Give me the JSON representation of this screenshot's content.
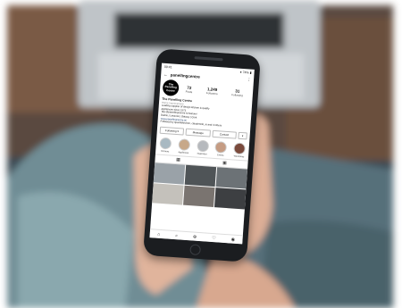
{
  "status": {
    "time": "09:41",
    "battery": "● 74% ▮"
  },
  "header": {
    "username": "panellingcentre",
    "back_icon": "back-arrow-icon",
    "menu_icon": "more-icon"
  },
  "profile": {
    "avatar_text": "The Panelling Centre",
    "stats": [
      {
        "value": "72",
        "label": "Posts"
      },
      {
        "value": "1,249",
        "label": "Followers"
      },
      {
        "value": "31",
        "label": "Following"
      }
    ]
  },
  "bio": {
    "name": "The Panelling Centre",
    "category": "Home Improvement",
    "line1": "Leading supplier of design kitchen & quality",
    "line2": "appliances since 1973.",
    "line3": "Tag @panellingcentre to feature!",
    "line4": "Dublin | Limerick | Galway | Cork",
    "link": "www.panellingcentre.ie/",
    "followed_by": "Followed by sparklekitchen, claudenolo_ie and 4 others"
  },
  "actions": {
    "following": "Following ▾",
    "message": "Message",
    "contact": "Contact",
    "more": "▾"
  },
  "highlights": [
    {
      "label": "Kitchens",
      "color": "#a9b9c2"
    },
    {
      "label": "Appliances",
      "color": "#c7a889"
    },
    {
      "label": "Inspiration",
      "color": "#b6b9bd"
    },
    {
      "label": "Events",
      "color": "#c59c83"
    },
    {
      "label": "Wardrobes",
      "color": "#7a4a3c"
    }
  ],
  "tabs": {
    "grid_icon": "grid-icon",
    "tagged_icon": "tagged-icon"
  },
  "grid_colors": [
    "#9aa2a8",
    "#4f5457",
    "#6c7276",
    "#c4c1bb",
    "#7a7470",
    "#3d3f42",
    "#b7b2ab",
    "#8d8f91",
    "#a7a39e"
  ],
  "nav": {
    "home": "⌂",
    "search": "⌕",
    "add": "⊕",
    "heart": "♡",
    "profile": "◉"
  }
}
